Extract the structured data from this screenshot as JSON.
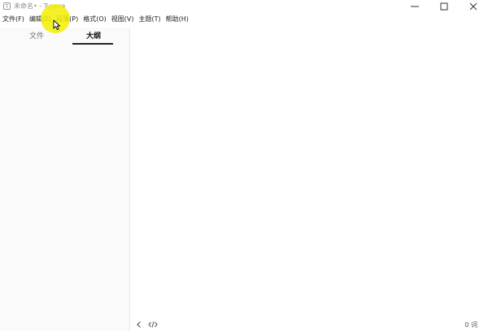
{
  "window": {
    "title": "未命名• - Typora",
    "app_icon_glyph": "T"
  },
  "menubar": {
    "items": [
      {
        "label": "文件(F)"
      },
      {
        "label": "编辑(E)"
      },
      {
        "label": "段落(P)"
      },
      {
        "label": "格式(O)"
      },
      {
        "label": "视图(V)"
      },
      {
        "label": "主题(T)"
      },
      {
        "label": "帮助(H)"
      }
    ]
  },
  "sidebar": {
    "tabs": [
      {
        "label": "文件",
        "active": false
      },
      {
        "label": "大纲",
        "active": true
      }
    ]
  },
  "statusbar": {
    "word_count": "0 词",
    "icons": [
      "chevron-left-icon",
      "source-code-icon"
    ]
  },
  "colors": {
    "sidebar_bg": "#fafafa",
    "cursor_highlight": "#f2ee00",
    "active_tab_underline": "#222222"
  }
}
